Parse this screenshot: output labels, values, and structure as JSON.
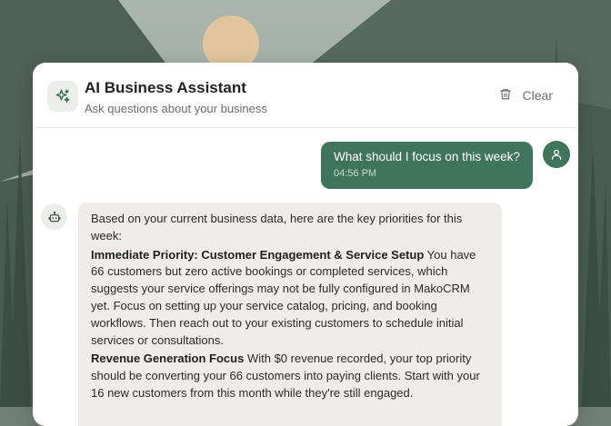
{
  "header": {
    "icon": "sparkles-icon",
    "title": "AI Business Assistant",
    "subtitle": "Ask questions about your business",
    "clear_label": "Clear",
    "clear_icon": "trash-icon"
  },
  "messages": {
    "user": {
      "text": "What should I focus on this week?",
      "time": "04:56 PM",
      "avatar_icon": "user-icon"
    },
    "assistant": {
      "avatar_icon": "bot-icon",
      "intro": "Based on your current business data, here are the key priorities for this week:",
      "sections": [
        {
          "heading": "Immediate Priority: Customer Engagement & Service Setup",
          "body": "You have 66 customers but zero active bookings or completed services, which suggests your service offerings may not be fully configured in MakoCRM yet. Focus on setting up your service catalog, pricing, and booking workflows. Then reach out to your existing customers to schedule initial services or consultations."
        },
        {
          "heading": "Revenue Generation Focus",
          "body": "With $0 revenue recorded, your top priority should be converting your 66 customers into paying clients. Start with your 16 new customers from this month while they're still engaged."
        }
      ]
    }
  },
  "colors": {
    "accent": "#3f765b",
    "assistant_bubble": "#efecea",
    "panel": "#ffffff"
  }
}
